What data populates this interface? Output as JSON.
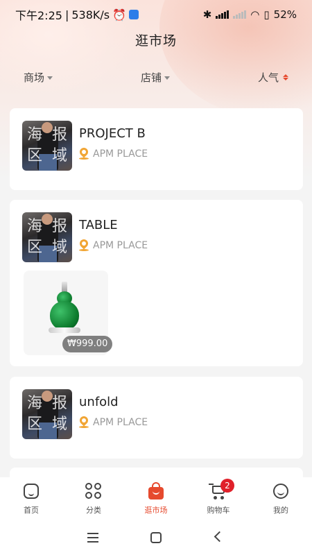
{
  "status_bar": {
    "time": "下午2:25",
    "speed": "538K/s",
    "battery": "52%"
  },
  "header": {
    "title": "逛市场"
  },
  "filters": [
    {
      "label": "商场"
    },
    {
      "label": "店铺"
    },
    {
      "label": "人气"
    }
  ],
  "poster_placeholder": {
    "chars": [
      "海",
      "报",
      "区",
      "域"
    ]
  },
  "stores": [
    {
      "name": "PROJECT B",
      "location": "APM PLACE"
    },
    {
      "name": "TABLE",
      "location": "APM PLACE",
      "products": [
        {
          "price": "₩999.00"
        }
      ]
    },
    {
      "name": "unfold",
      "location": "APM PLACE"
    }
  ],
  "tab_bar": {
    "items": [
      {
        "label": "首页",
        "icon": "home-icon"
      },
      {
        "label": "分类",
        "icon": "category-icon"
      },
      {
        "label": "逛市场",
        "icon": "shopping-bag-icon",
        "active": true
      },
      {
        "label": "购物车",
        "icon": "cart-icon",
        "badge": "2"
      },
      {
        "label": "我的",
        "icon": "profile-icon"
      }
    ]
  },
  "colors": {
    "accent": "#e64a2e",
    "badge": "#e0202a",
    "pin": "#f1a534"
  }
}
